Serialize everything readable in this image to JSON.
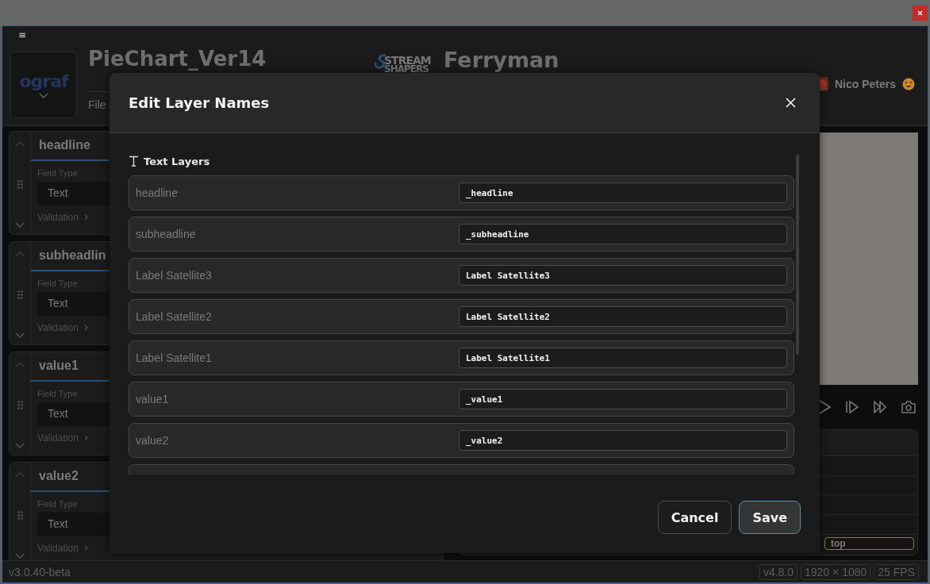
{
  "menu": {
    "icon": "≡"
  },
  "header": {
    "logo": "ograf",
    "project_title": "PieChart_Ver14",
    "menu_items": [
      "File"
    ],
    "brand": {
      "line1": "STREAM",
      "line2": "SHAPERS"
    },
    "app_name": "Ferryman",
    "user": {
      "name": "Nico Peters"
    }
  },
  "fields": [
    {
      "title": "headline",
      "field_type_label": "Field Type",
      "field_type": "Text",
      "validation": "Validation"
    },
    {
      "title": "subheadlin",
      "field_type_label": "Field Type",
      "field_type": "Text",
      "validation": "Validation"
    },
    {
      "title": "value1",
      "field_type_label": "Field Type",
      "field_type": "Text",
      "validation": "Validation"
    },
    {
      "title": "value2",
      "field_type_label": "Field Type",
      "field_type": "Text",
      "validation": "Validation"
    }
  ],
  "queue": {
    "field_value": "top"
  },
  "status_bar": {
    "version": "v3.0.40-beta",
    "badges": [
      "v4.8.0",
      "1920 × 1080",
      "25 FPS"
    ]
  },
  "dialog": {
    "title": "Edit Layer Names",
    "section": "Text Layers",
    "layers": [
      {
        "name": "headline",
        "value": "_headline"
      },
      {
        "name": "subheadline",
        "value": "_subheadline"
      },
      {
        "name": "Label Satellite3",
        "value": "Label Satellite3"
      },
      {
        "name": "Label Satellite2",
        "value": "Label Satellite2"
      },
      {
        "name": "Label Satellite1",
        "value": "Label Satellite1"
      },
      {
        "name": "value1",
        "value": "_value1"
      },
      {
        "name": "value2",
        "value": "_value2"
      }
    ],
    "buttons": [
      {
        "label": "Cancel",
        "kind": "secondary"
      },
      {
        "label": "Save",
        "kind": "primary"
      }
    ]
  }
}
